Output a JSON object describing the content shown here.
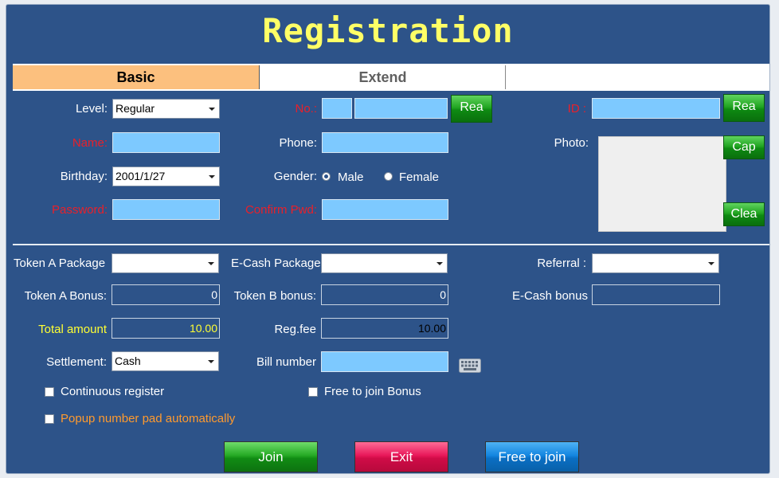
{
  "title": "Registration",
  "tabs": [
    {
      "label": "Basic",
      "active": true
    },
    {
      "label": "Extend",
      "active": false
    }
  ],
  "basic": {
    "level_label": "Level:",
    "level_value": "Regular",
    "no_label": "No.:",
    "no_read_button": "Rea",
    "id_label": "ID :",
    "id_read_button": "Rea",
    "name_label": "Name:",
    "phone_label": "Phone:",
    "photo_label": "Photo:",
    "capture_button": "Cap",
    "clear_button": "Clea",
    "birthday_label": "Birthday:",
    "birthday_value": "2001/1/27",
    "gender_label": "Gender:",
    "gender_options": [
      "Male",
      "Female"
    ],
    "gender_selected": "Male",
    "password_label": "Password:",
    "confirm_pwd_label": "Confirm Pwd:"
  },
  "package": {
    "token_a_package_label": "Token A Package",
    "ecash_package_label": "E-Cash Package",
    "referral_label": "Referral  :",
    "token_a_bonus_label": "Token A Bonus:",
    "token_a_bonus_value": "0",
    "token_b_bonus_label": "Token B bonus:",
    "token_b_bonus_value": "0",
    "ecash_bonus_label": "E-Cash bonus",
    "total_amount_label": "Total amount",
    "total_amount_value": "10.00",
    "reg_fee_label": "Reg.fee",
    "reg_fee_value": "10.00",
    "settlement_label": "Settlement:",
    "settlement_value": "Cash",
    "bill_number_label": "Bill number"
  },
  "options": {
    "continuous_register": "Continuous register",
    "free_to_join_bonus": "Free to join Bonus",
    "popup_number_pad": "Popup number pad automatically"
  },
  "actions": {
    "join": "Join",
    "exit": "Exit",
    "free_to_join": "Free to join"
  },
  "colors": {
    "background": "#2d5389",
    "title": "#ffff66",
    "required_label": "#e8202a",
    "input_fill": "#7dc9ff",
    "active_tab": "#fcc07e"
  }
}
